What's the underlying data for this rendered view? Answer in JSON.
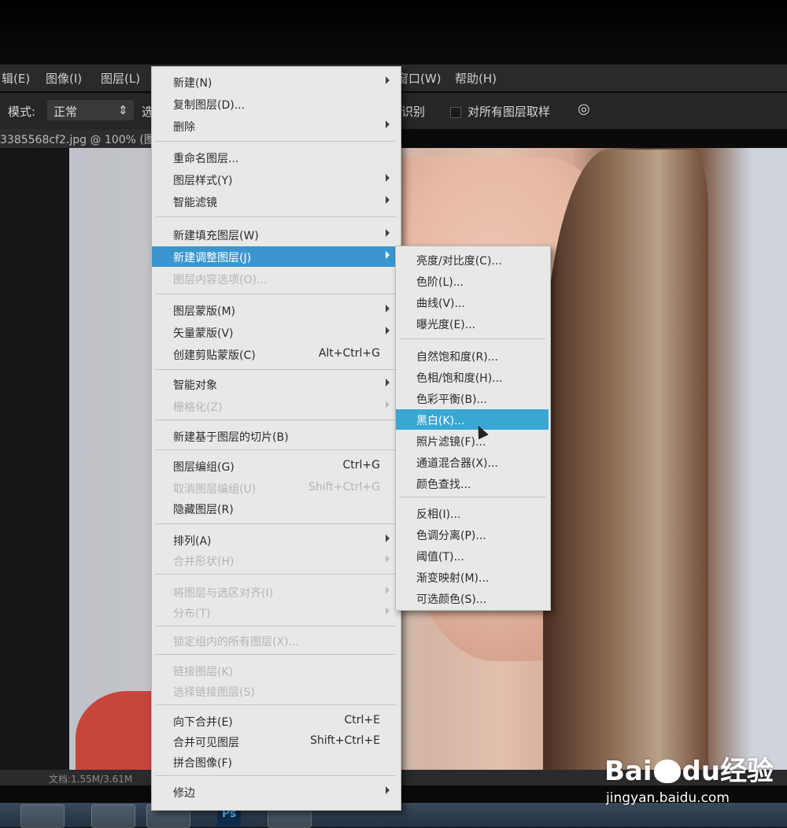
{
  "menubar": {
    "items": [
      "辑(E)",
      "图像(I)",
      "图层(L)",
      "窗口(W)",
      "帮助(H)"
    ]
  },
  "options": {
    "mode_label": "模式:",
    "mode_value": "正常",
    "partial_char": "选",
    "recognize_label": "识别",
    "sample_all_label": "对所有图层取样"
  },
  "document": {
    "tab_title": "3385568cf2.jpg @ 100% (图",
    "status": "文档:1.55M/3.61M"
  },
  "layer_menu": {
    "items": [
      {
        "label": "新建(N)",
        "shortcut": "",
        "submenu": true,
        "disabled": false
      },
      {
        "label": "复制图层(D)...",
        "shortcut": "",
        "submenu": false,
        "disabled": false
      },
      {
        "label": "删除",
        "shortcut": "",
        "submenu": true,
        "disabled": false
      },
      {
        "label": "重命名图层...",
        "shortcut": "",
        "submenu": false,
        "disabled": false
      },
      {
        "label": "图层样式(Y)",
        "shortcut": "",
        "submenu": true,
        "disabled": false
      },
      {
        "label": "智能滤镜",
        "shortcut": "",
        "submenu": true,
        "disabled": false
      },
      {
        "label": "新建填充图层(W)",
        "shortcut": "",
        "submenu": true,
        "disabled": false
      },
      {
        "label": "新建调整图层(J)",
        "shortcut": "",
        "submenu": true,
        "disabled": false,
        "highlighted": true
      },
      {
        "label": "图层内容选项(O)...",
        "shortcut": "",
        "submenu": false,
        "disabled": true
      },
      {
        "label": "图层蒙版(M)",
        "shortcut": "",
        "submenu": true,
        "disabled": false
      },
      {
        "label": "矢量蒙版(V)",
        "shortcut": "",
        "submenu": true,
        "disabled": false
      },
      {
        "label": "创建剪贴蒙版(C)",
        "shortcut": "Alt+Ctrl+G",
        "submenu": false,
        "disabled": false
      },
      {
        "label": "智能对象",
        "shortcut": "",
        "submenu": true,
        "disabled": false
      },
      {
        "label": "栅格化(Z)",
        "shortcut": "",
        "submenu": true,
        "disabled": true
      },
      {
        "label": "新建基于图层的切片(B)",
        "shortcut": "",
        "submenu": false,
        "disabled": false
      },
      {
        "label": "图层编组(G)",
        "shortcut": "Ctrl+G",
        "submenu": false,
        "disabled": false
      },
      {
        "label": "取消图层编组(U)",
        "shortcut": "Shift+Ctrl+G",
        "submenu": false,
        "disabled": true
      },
      {
        "label": "隐藏图层(R)",
        "shortcut": "",
        "submenu": false,
        "disabled": false
      },
      {
        "label": "排列(A)",
        "shortcut": "",
        "submenu": true,
        "disabled": false
      },
      {
        "label": "合并形状(H)",
        "shortcut": "",
        "submenu": true,
        "disabled": true
      },
      {
        "label": "将图层与选区对齐(I)",
        "shortcut": "",
        "submenu": true,
        "disabled": true
      },
      {
        "label": "分布(T)",
        "shortcut": "",
        "submenu": true,
        "disabled": true
      },
      {
        "label": "锁定组内的所有图层(X)...",
        "shortcut": "",
        "submenu": false,
        "disabled": true
      },
      {
        "label": "链接图层(K)",
        "shortcut": "",
        "submenu": false,
        "disabled": true
      },
      {
        "label": "选择链接图层(S)",
        "shortcut": "",
        "submenu": false,
        "disabled": true
      },
      {
        "label": "向下合并(E)",
        "shortcut": "Ctrl+E",
        "submenu": false,
        "disabled": false
      },
      {
        "label": "合并可见图层",
        "shortcut": "Shift+Ctrl+E",
        "submenu": false,
        "disabled": false
      },
      {
        "label": "拼合图像(F)",
        "shortcut": "",
        "submenu": false,
        "disabled": false
      },
      {
        "label": "修边",
        "shortcut": "",
        "submenu": true,
        "disabled": false
      }
    ]
  },
  "adjustment_submenu": {
    "items": [
      {
        "label": "亮度/对比度(C)..."
      },
      {
        "label": "色阶(L)..."
      },
      {
        "label": "曲线(V)..."
      },
      {
        "label": "曝光度(E)..."
      },
      {
        "label": "自然饱和度(R)..."
      },
      {
        "label": "色相/饱和度(H)..."
      },
      {
        "label": "色彩平衡(B)..."
      },
      {
        "label": "黑白(K)...",
        "highlighted": true
      },
      {
        "label": "照片滤镜(F)..."
      },
      {
        "label": "通道混合器(X)..."
      },
      {
        "label": "颜色查找..."
      },
      {
        "label": "反相(I)..."
      },
      {
        "label": "色调分离(P)..."
      },
      {
        "label": "阈值(T)..."
      },
      {
        "label": "渐变映射(M)..."
      },
      {
        "label": "可选颜色(S)..."
      }
    ]
  },
  "taskbar": {
    "ps_icon_label": "Ps"
  },
  "watermark": {
    "brand": "Bai",
    "brand_suffix": "du",
    "brand_cn": "经验",
    "url": "jingyan.baidu.com"
  },
  "colors": {
    "highlight": "#3b96cf",
    "menu_bg": "#e8e9e7"
  }
}
